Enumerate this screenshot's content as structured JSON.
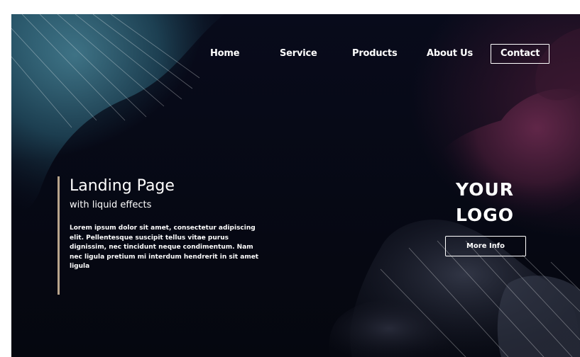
{
  "nav": {
    "items": [
      {
        "label": "Home"
      },
      {
        "label": "Service"
      },
      {
        "label": "Products"
      },
      {
        "label": "About Us"
      },
      {
        "label": "Contact"
      }
    ]
  },
  "hero": {
    "title": "Landing Page",
    "subtitle": "with liquid effects",
    "body": "Lorem ipsum dolor sit amet, consectetur adipiscing elit. Pellentesque suscipit tellus vitae purus dignissim, nec tincidunt neque condimentum. Nam nec ligula pretium mi interdum hendrerit in sit amet ligula"
  },
  "logo": {
    "line1": "YOUR",
    "line2": "LOGO"
  },
  "cta": {
    "label": "More Info"
  },
  "colors": {
    "background": "#05070f",
    "teal_accent": "#2f6277",
    "magenta_accent": "#3b1730",
    "accent_bar": "#b9a58c",
    "text": "#ffffff"
  }
}
